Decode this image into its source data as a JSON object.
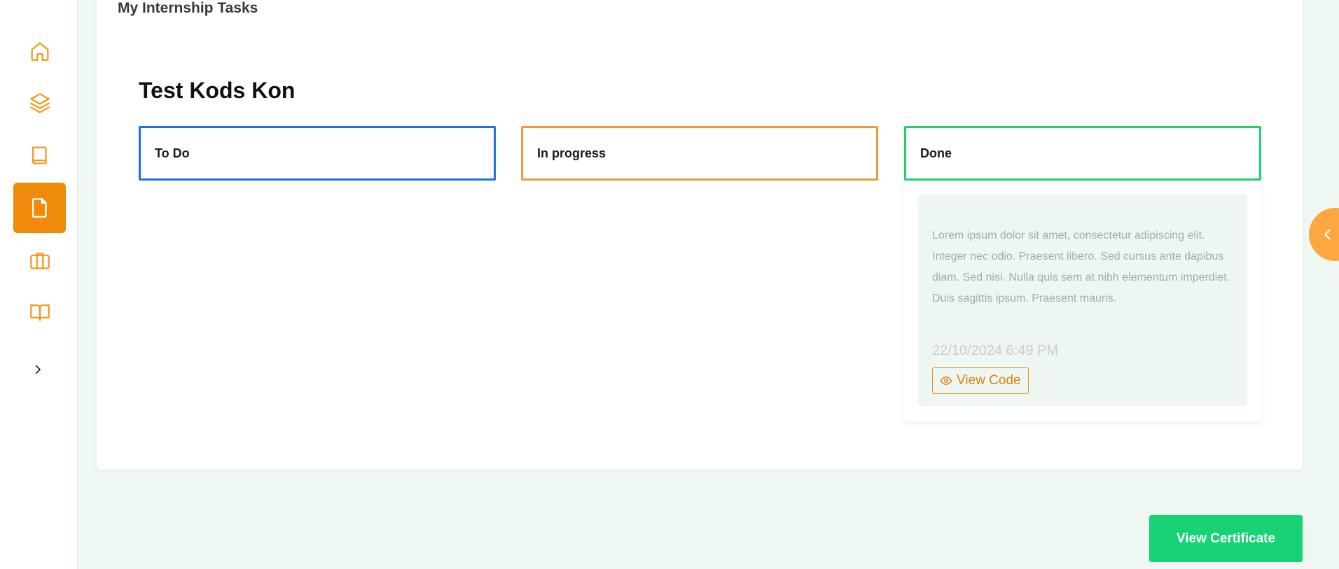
{
  "page": {
    "heading": "My Internship Tasks"
  },
  "sidebar": {
    "items": [
      {
        "icon": "home-icon",
        "active": false
      },
      {
        "icon": "layers-icon",
        "active": false
      },
      {
        "icon": "book-icon",
        "active": false
      },
      {
        "icon": "file-icon",
        "active": true
      },
      {
        "icon": "briefcase-icon",
        "active": false
      },
      {
        "icon": "book-open-icon",
        "active": false
      }
    ],
    "expand_icon": "chevron-right-icon"
  },
  "board": {
    "title": "Test Kods Kon",
    "columns": [
      {
        "label": "To Do",
        "color": "#1e6fe6"
      },
      {
        "label": "In progress",
        "color": "#f6963a"
      },
      {
        "label": "Done",
        "color": "#1fcf72"
      }
    ],
    "done_tasks": [
      {
        "description": "Lorem ipsum dolor sit amet, consectetur adipiscing elit. Integer nec odio. Praesent libero. Sed cursus ante dapibus diam. Sed nisi. Nulla quis sem at nibh elementum imperdiet. Duis sagittis ipsum. Praesent mauris.",
        "date": "22/10/2024 6:49 PM",
        "action_label": "View Code",
        "action_icon": "eye-icon"
      }
    ]
  },
  "side_tab": {
    "icon": "chevron-left-icon"
  },
  "footer": {
    "certificate_label": "View Certificate"
  },
  "colors": {
    "accent": "#f08a0a",
    "success": "#17d375",
    "background": "#eff7f2"
  }
}
